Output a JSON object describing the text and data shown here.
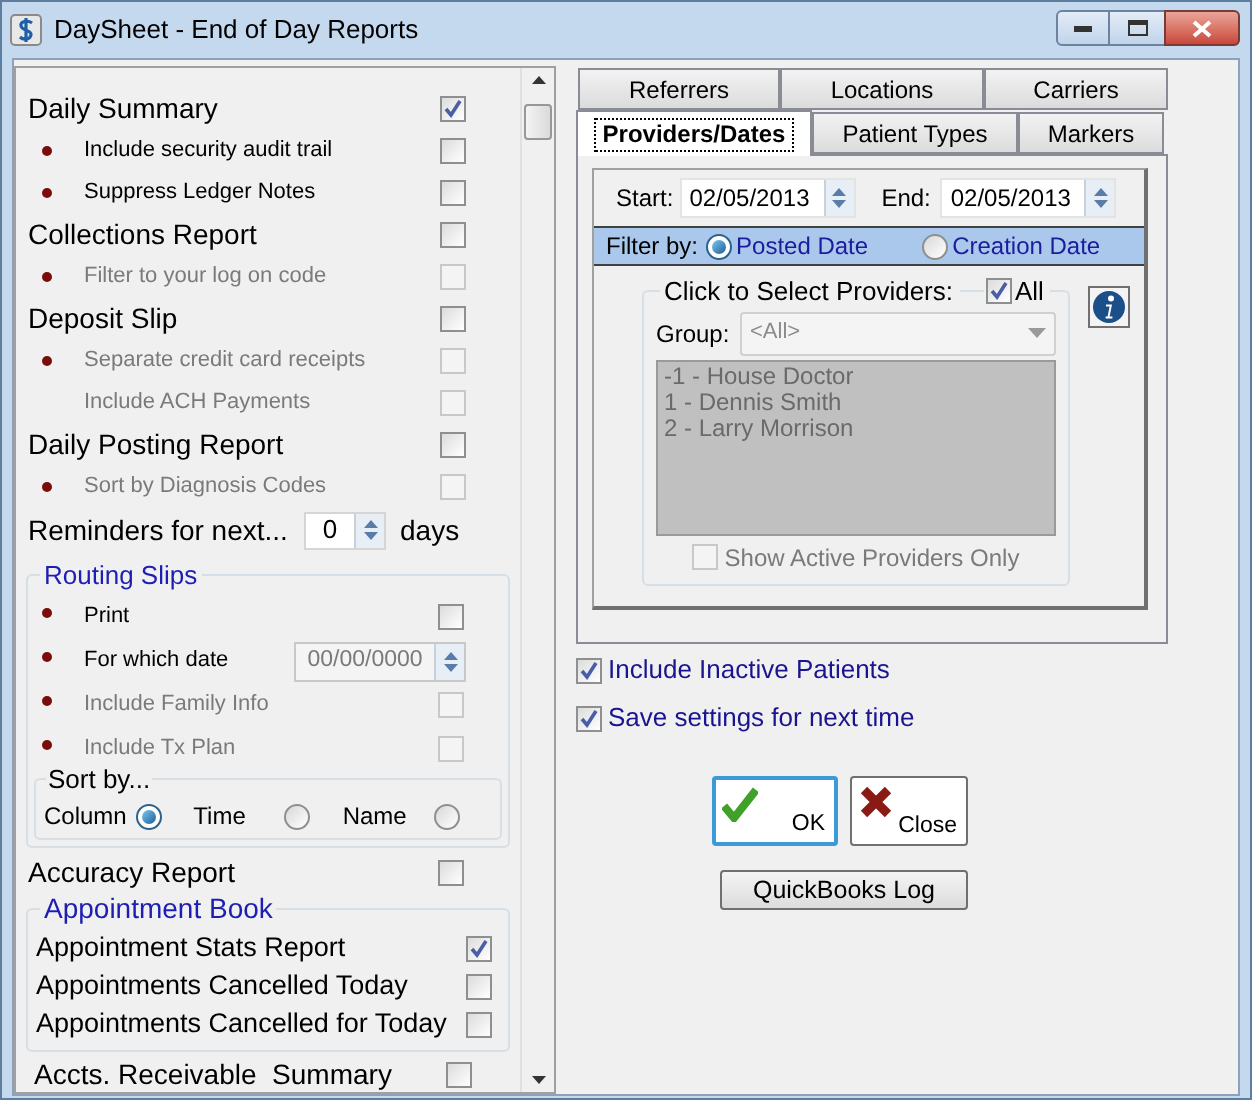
{
  "window": {
    "title": "DaySheet - End of Day Reports"
  },
  "report_options": [
    {
      "kind": "header",
      "label": "Daily Summary",
      "checked": true,
      "disabled": false
    },
    {
      "kind": "option",
      "label": "Include security audit trail",
      "checked": false,
      "disabled": false,
      "bullet": true
    },
    {
      "kind": "option",
      "label": "Suppress Ledger Notes",
      "checked": false,
      "disabled": false,
      "bullet": true
    },
    {
      "kind": "header",
      "label": "Collections Report",
      "checked": false,
      "disabled": false
    },
    {
      "kind": "option",
      "label": "Filter to your log on code",
      "checked": false,
      "disabled": true,
      "bullet": true
    },
    {
      "kind": "header",
      "label": "Deposit Slip",
      "checked": false,
      "disabled": false
    },
    {
      "kind": "option",
      "label": "Separate credit card receipts",
      "checked": false,
      "disabled": true,
      "bullet": true
    },
    {
      "kind": "option",
      "label": "Include ACH Payments",
      "checked": false,
      "disabled": true,
      "bullet": false
    },
    {
      "kind": "header",
      "label": "Daily Posting Report",
      "checked": false,
      "disabled": false
    },
    {
      "kind": "option",
      "label": "Sort by Diagnosis Codes",
      "checked": false,
      "disabled": true,
      "bullet": true
    }
  ],
  "reminders": {
    "label": "Reminders for next...",
    "value": "0",
    "unit": "days"
  },
  "routing_slips": {
    "title": "Routing Slips",
    "options": [
      {
        "kind": "check",
        "label": "Print",
        "checked": false,
        "disabled": false
      },
      {
        "kind": "date",
        "label": "For which date",
        "value": "00/00/0000"
      },
      {
        "kind": "check",
        "label": "Include Family Info",
        "checked": false,
        "disabled": true
      },
      {
        "kind": "check",
        "label": "Include Tx Plan",
        "checked": false,
        "disabled": true
      }
    ],
    "sort_by": {
      "title": "Sort by...",
      "options": [
        {
          "label": "Column",
          "selected": true
        },
        {
          "label": "Time",
          "selected": false
        },
        {
          "label": "Name",
          "selected": false
        }
      ]
    }
  },
  "accuracy_report": {
    "label": "Accuracy Report",
    "checked": false
  },
  "appointment_book": {
    "title": "Appointment Book",
    "options": [
      {
        "label": "Appointment Stats Report",
        "checked": true
      },
      {
        "label": "Appointments Cancelled Today",
        "checked": false
      },
      {
        "label": "Appointments Cancelled for Today",
        "checked": false
      }
    ]
  },
  "accts_receivable": {
    "label": "Accts. Receivable  Summary",
    "checked": false
  },
  "tab_rows": [
    [
      {
        "label": "Referrers",
        "selected": false
      },
      {
        "label": "Locations",
        "selected": false
      },
      {
        "label": "Carriers",
        "selected": false
      }
    ],
    [
      {
        "label": "Providers/Dates",
        "selected": true
      },
      {
        "label": "Patient Types",
        "selected": false
      },
      {
        "label": "Markers",
        "selected": false
      }
    ]
  ],
  "dates": {
    "start_label": "Start:",
    "start": "02/05/2013",
    "end_label": "End:",
    "end": "02/05/2013"
  },
  "filter": {
    "label": "Filter by:",
    "options": [
      {
        "label": "Posted Date",
        "selected": true
      },
      {
        "label": "Creation Date",
        "selected": false
      }
    ]
  },
  "providers": {
    "title": "Click to Select Providers:",
    "all_label": "All",
    "all_checked": true,
    "group_label": "Group:",
    "group_value": "<All>",
    "list": [
      "-1 - House Doctor",
      "1 - Dennis Smith",
      "2 - Larry Morrison"
    ],
    "active_only": {
      "label": "Show Active Providers Only",
      "checked": false
    }
  },
  "include_inactive": {
    "label": "Include Inactive Patients",
    "checked": true
  },
  "save_settings": {
    "label": "Save settings for next time",
    "checked": true
  },
  "buttons": [
    {
      "kind": "ok",
      "label": "OK"
    },
    {
      "kind": "close",
      "label": "Close"
    }
  ],
  "quickbooks_button": "QuickBooks Log"
}
